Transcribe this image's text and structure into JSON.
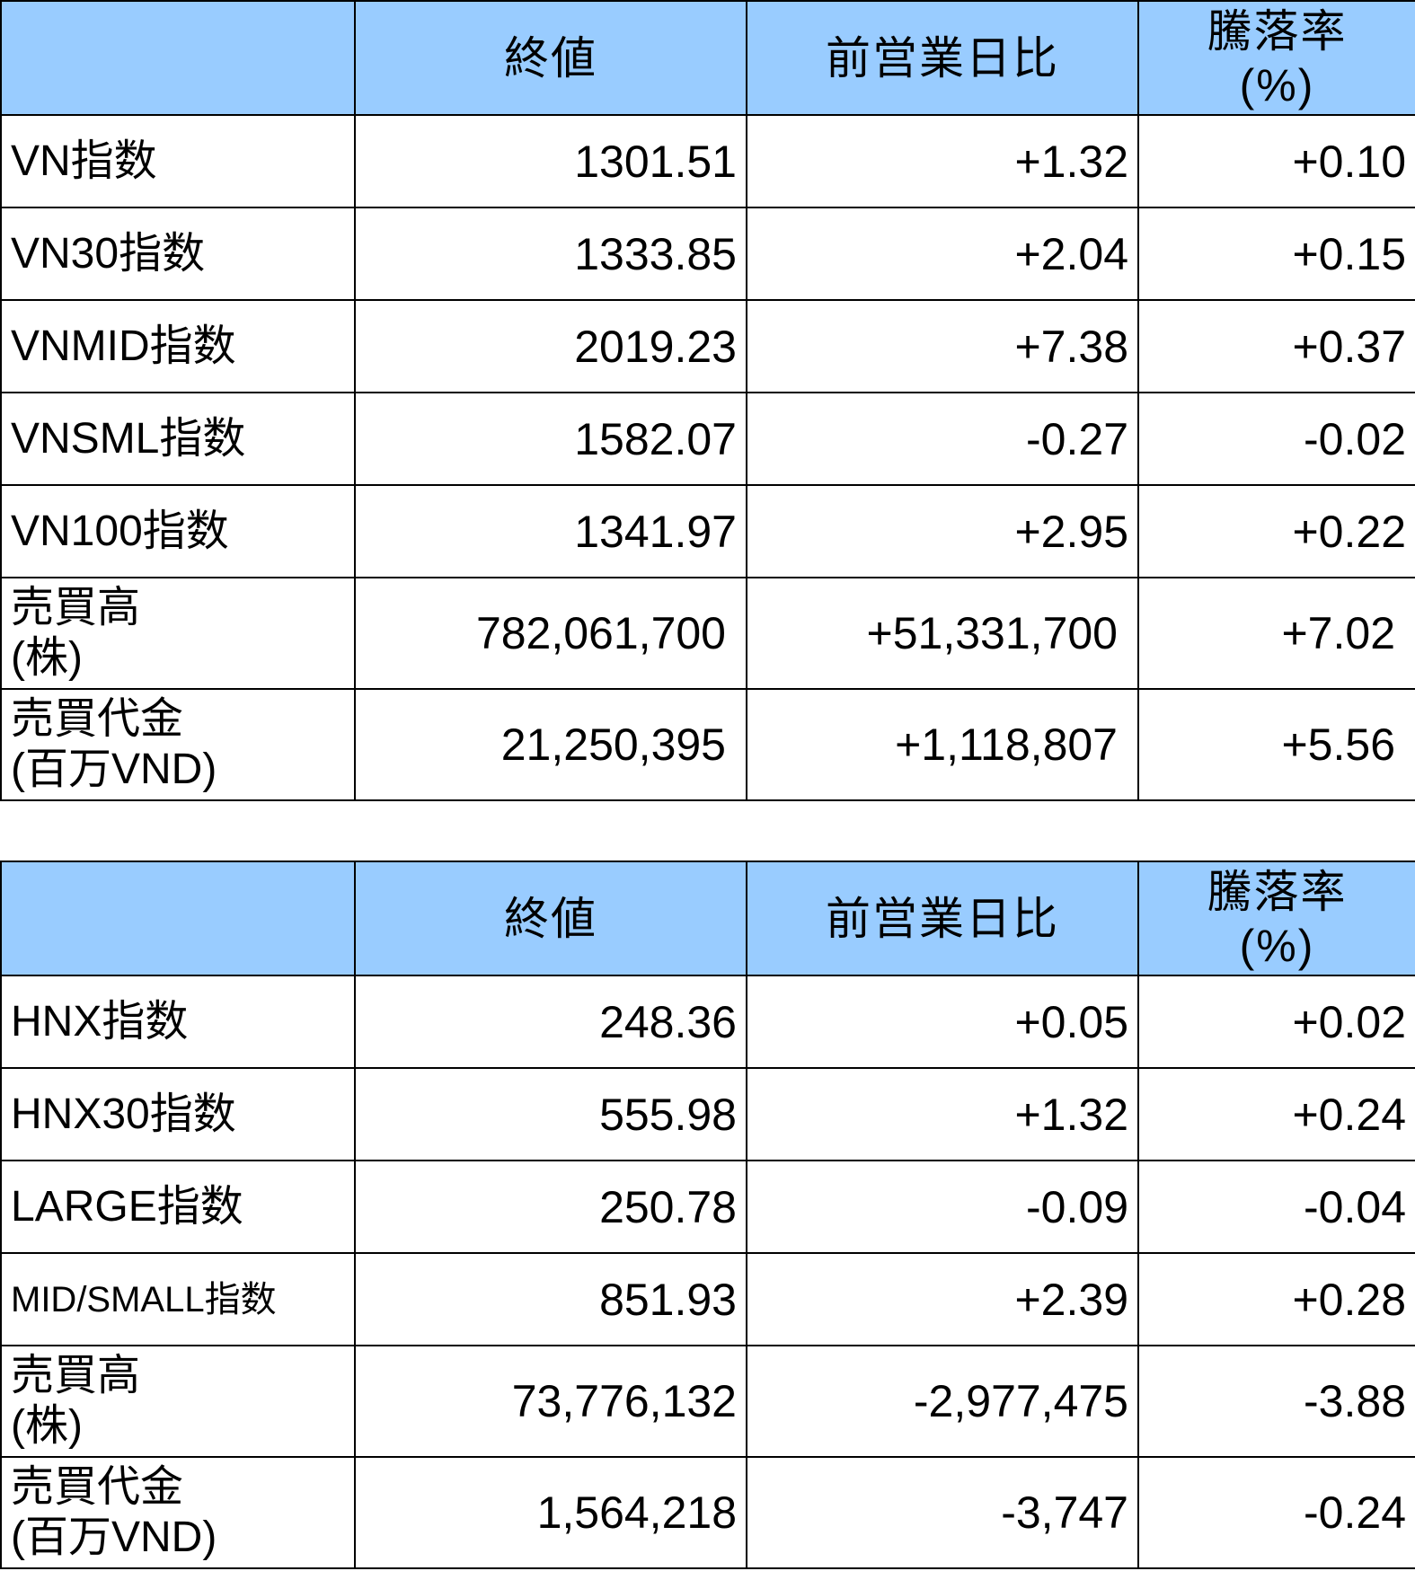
{
  "table1": {
    "headers": {
      "blank": "",
      "close": "終値",
      "change": "前営業日比",
      "pct_line1": "騰落率",
      "pct_line2": "(%)"
    },
    "rows": [
      {
        "label": "VN指数",
        "label2": "",
        "close": "1301.51",
        "change": "+1.32",
        "pct": "+0.10"
      },
      {
        "label": "VN30指数",
        "label2": "",
        "close": "1333.85",
        "change": "+2.04",
        "pct": "+0.15"
      },
      {
        "label": "VNMID指数",
        "label2": "",
        "close": "2019.23",
        "change": "+7.38",
        "pct": "+0.37"
      },
      {
        "label": "VNSML指数",
        "label2": "",
        "close": "1582.07",
        "change": "-0.27",
        "pct": "-0.02"
      },
      {
        "label": "VN100指数",
        "label2": "",
        "close": "1341.97",
        "change": "+2.95",
        "pct": "+0.22"
      },
      {
        "label": "売買高",
        "label2": "(株)",
        "close": "782,061,700",
        "change": "+51,331,700",
        "pct": "+7.02"
      },
      {
        "label": "売買代金",
        "label2": "(百万VND)",
        "close": "21,250,395",
        "change": "+1,118,807",
        "pct": "+5.56"
      }
    ]
  },
  "table2": {
    "headers": {
      "blank": "",
      "close": "終値",
      "change": "前営業日比",
      "pct_line1": "騰落率",
      "pct_line2": "(%)"
    },
    "rows": [
      {
        "label": "HNX指数",
        "label2": "",
        "close": "248.36",
        "change": "+0.05",
        "pct": "+0.02"
      },
      {
        "label": "HNX30指数",
        "label2": "",
        "close": "555.98",
        "change": "+1.32",
        "pct": "+0.24"
      },
      {
        "label": "LARGE指数",
        "label2": "",
        "close": "250.78",
        "change": "-0.09",
        "pct": "-0.04"
      },
      {
        "label": "MID/SMALL指数",
        "label2": "",
        "close": "851.93",
        "change": "+2.39",
        "pct": "+0.28"
      },
      {
        "label": "売買高",
        "label2": "(株)",
        "close": "73,776,132",
        "change": "-2,977,475",
        "pct": "-3.88"
      },
      {
        "label": "売買代金",
        "label2": "(百万VND)",
        "close": "1,564,218",
        "change": "-3,747",
        "pct": "-0.24"
      }
    ]
  },
  "colors": {
    "header_bg": "#99ccff",
    "border": "#000000",
    "text": "#000000"
  }
}
